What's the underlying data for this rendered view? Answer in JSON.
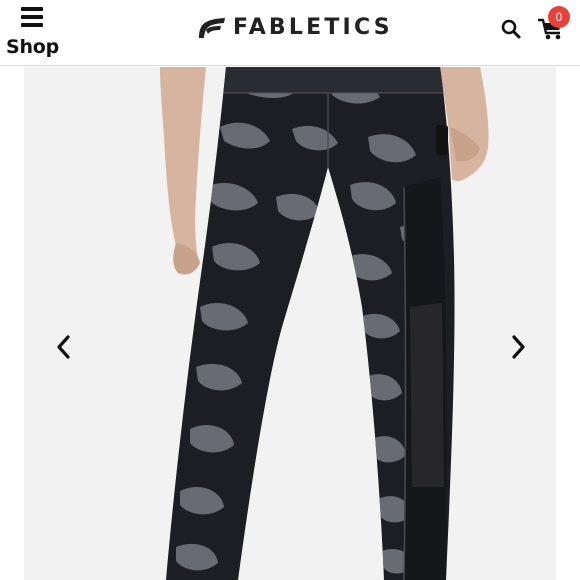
{
  "header": {
    "menu_label": "Shop",
    "brand": "FABLETICS",
    "cart_count": "0",
    "icons": {
      "menu": "hamburger-icon",
      "search": "search-icon",
      "cart": "cart-icon",
      "prev": "chevron-left-icon",
      "next": "chevron-right-icon"
    }
  },
  "colors": {
    "badge": "#e8423a",
    "legging_base": "#1c1e24",
    "camo_gray": "#777a80",
    "skin": "#d9b8a3"
  }
}
